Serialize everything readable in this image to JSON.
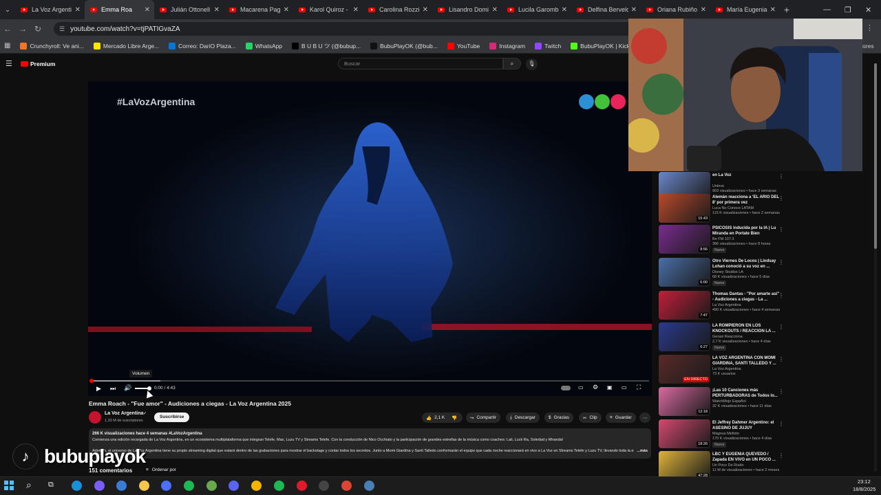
{
  "browser": {
    "tabs": [
      {
        "label": "La Voz Argenti"
      },
      {
        "label": "Emma Roa",
        "active": true
      },
      {
        "label": "Julián Ottonell"
      },
      {
        "label": "Macarena Pag"
      },
      {
        "label": "Karol Quiroz -"
      },
      {
        "label": "Carolina Rozzi"
      },
      {
        "label": "Lisandro Domi"
      },
      {
        "label": "Lucila Garomb"
      },
      {
        "label": "Delfina Berveld"
      },
      {
        "label": "Oriana Rubiño"
      },
      {
        "label": "María Eugenia"
      }
    ],
    "url": "youtube.com/watch?v=tjPATIGvaZA",
    "bookmarks": [
      {
        "label": "Crunchyroll: Ve ani...",
        "color": "#f47521"
      },
      {
        "label": "Mercado Libre Arge...",
        "color": "#ffe600"
      },
      {
        "label": "Correo: DariO Plaza...",
        "color": "#0078d4"
      },
      {
        "label": "WhatsApp",
        "color": "#25d366"
      },
      {
        "label": "B U B U ツ (@bubup...",
        "color": "#000000"
      },
      {
        "label": "BubuPlayOK (@bub...",
        "color": "#111111"
      },
      {
        "label": "YouTube",
        "color": "#ff0000"
      },
      {
        "label": "Instagram",
        "color": "#d62976"
      },
      {
        "label": "Twitch",
        "color": "#9146ff"
      },
      {
        "label": "BubuPlayOK | Kick",
        "color": "#53fc18"
      },
      {
        "label": "PROMIED",
        "color": "#3cb043"
      }
    ],
    "bookmarks_more": "ores"
  },
  "youtube": {
    "logo_text": "Premium",
    "search_placeholder": "Buscar",
    "video_watermark": "#LaVozArgentina",
    "tooltip": "Volumen",
    "time": "0:00 / 4:43",
    "title": "Emma Roach - \"Fue amor\" - Audiciones a ciegas - La Voz Argentina 2025",
    "channel": "La Voz Argentina",
    "subscribers": "1,33 M de suscriptores",
    "subscribe_label": "Suscribirse",
    "likes": "2,1 K",
    "share": "Compartir",
    "download": "Descargar",
    "thanks": "Gracias",
    "clip": "Clip",
    "save": "Guardar",
    "desc_meta": "266 K visualizaciones  hace 4 semanas  #LaVozArgentina",
    "desc_line1": "Comienza una edición recargada de La Voz Argentina, en un ecosistema multiplataforma que integran Telefe, Max, Luzu TV y Streams Telefe. Con la conducción de Nico Occhiato y la participación de grandes estrellas de la música como coaches: Lali, Luck Ra, Soledad y Miranda!",
    "desc_line2": "Además, el universo de La Voz Argentina tiene su propio streaming digital que estará dentro de las grabaciones para mostrar el backstage y contar todos los secretos. Junto a Momi Giardina y Santi Talledo conformarán el equipo que cada noche reaccionará en vivo a La Voz en Streams Telefe y Luzu TV, llevando toda la emoción",
    "desc_more": "...más",
    "comments": "151 comentarios",
    "sort": "Ordenar por",
    "overlay_brand": "bubuplayok"
  },
  "sidebar": [
    {
      "title": "en La Voz",
      "channel": "Unleve",
      "meta": "903 visualizaciones • hace 3 semanas",
      "duration": "15:31",
      "thumb": "#6b86c9",
      "new": false
    },
    {
      "title": "Alemán reacciona a 'EL ARIO DEL 8' por primera vez",
      "channel": "Luca No Conoce LATAM",
      "meta": "115 K visualizaciones • hace 2 semanas",
      "duration": "15:43",
      "thumb": "#b84a2c",
      "new": false
    },
    {
      "title": "PSICOSIS inducida por la IA | Lu Miranda en Portate Bien",
      "channel": "Be FM 107.3",
      "meta": "386 visualizaciones • hace 8 horas",
      "duration": "8:56",
      "thumb": "#7a2c8f",
      "new": true
    },
    {
      "title": "Otro Viernes De Locos | Lindsay Lohan conoció a su voz en ...",
      "channel": "Disney Studios LA",
      "meta": "68 K visualizaciones • hace 5 días",
      "duration": "6:00",
      "thumb": "#4a6fa8",
      "new": true
    },
    {
      "title": "Thomas Dantas - \"Por amarte así\" - Audiciones a ciegas - La ...",
      "channel": "La Voz Argentina",
      "meta": "490 K visualizaciones • hace 4 semanas",
      "duration": "7:47",
      "thumb": "#c21f3a",
      "new": false
    },
    {
      "title": "LA ROMPIERON EN LOS KNOCKOUTS / REACCION LA ...",
      "channel": "Gerasi Reacciona",
      "meta": "2,7 K visualizaciones • hace 4 días",
      "duration": "6:27",
      "thumb": "#2b3a8c",
      "new": true
    },
    {
      "title": "LA VOZ ARGENTINA CON MOMI GIARDINA, SANTI TALLEDO Y ...",
      "channel": "La Voz Argentina",
      "meta": "73 K usuarios",
      "duration": "EN DIRECTO",
      "thumb": "#5a2a2a",
      "new": false
    },
    {
      "title": "¡Las 10 Canciones más PERTURBADORAS de Todos lo...",
      "channel": "WatchMojo Español",
      "meta": "32 K visualizaciones • hace 11 días",
      "duration": "12:18",
      "thumb": "#d96aa0",
      "new": false
    },
    {
      "title": "El Jeffrey Dahmer Argentino: el ASESINO DE JUJUY",
      "channel": "Magnus Mefisto",
      "meta": "170 K visualizaciones • hace 4 días",
      "duration": "18:26",
      "thumb": "#d34a6f",
      "new": true
    },
    {
      "title": "LBC Y EUGENIA QUEVEDO / Zapada EN VIVO en UN POCO ...",
      "channel": "Un Poco De Ruido",
      "meta": "11 M de visualizaciones • hace 2 meses",
      "duration": "47:28",
      "thumb": "#e0b33a",
      "new": false
    }
  ],
  "taskbar": {
    "time": "23:12",
    "date": "18/8/2025"
  },
  "colors": {
    "yt_red": "#ff0000",
    "bg": "#0f0f0f"
  }
}
